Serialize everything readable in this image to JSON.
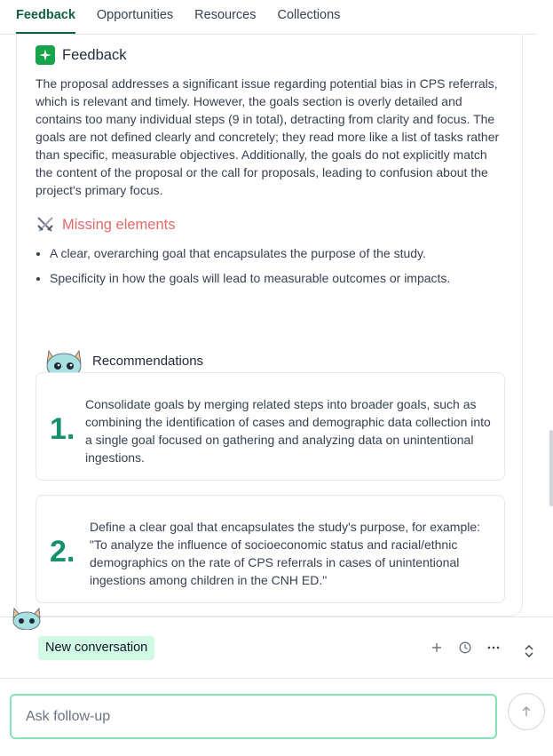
{
  "tabs": [
    {
      "label": "Feedback",
      "active": true
    },
    {
      "label": "Opportunities",
      "active": false
    },
    {
      "label": "Resources",
      "active": false
    },
    {
      "label": "Collections",
      "active": false
    }
  ],
  "feedback": {
    "icon": "sparkle-icon",
    "title": "Feedback",
    "body": "The proposal addresses a significant issue regarding potential bias in CPS referrals, which is relevant and timely. However, the goals section is overly detailed and contains too many individual steps (9 in total), detracting from clarity and focus. The goals are not defined clearly and concretely; they read more like a list of tasks rather than specific, measurable objectives. Additionally, the goals do not explicitly match the content of the proposal or the call for proposals, leading to confusion about the project's primary focus."
  },
  "missing": {
    "icon": "crossed-swords-icon",
    "title": "Missing elements",
    "items": [
      "A clear, overarching goal that encapsulates the purpose of the study.",
      "Specificity in how the goals will lead to measurable outcomes or impacts."
    ]
  },
  "recommendations": {
    "title": "Recommendations",
    "items": [
      {
        "num": "1.",
        "text": "Consolidate goals by merging related steps into broader goals, such as combining the identification of cases and demographic data collection into a single goal focused on gathering and analyzing data on unintentional ingestions."
      },
      {
        "num": "2.",
        "text": "Define a clear goal that encapsulates the study's purpose, for example: \"To analyze the influence of socioeconomic status and racial/ethnic demographics on the rate of CPS referrals in cases of unintentional ingestions among children in the CNH ED.\""
      }
    ]
  },
  "conversation": {
    "new_label": "New conversation",
    "icons": [
      "plus-icon",
      "history-icon",
      "more-icon",
      "expand-icon"
    ]
  },
  "input": {
    "placeholder": "Ask follow-up"
  },
  "colors": {
    "accent": "#0f5e45",
    "number": "#14906b",
    "missing": "#e46a6a",
    "input_border": "#86e0b8",
    "badge_bg": "#d1fae5"
  }
}
